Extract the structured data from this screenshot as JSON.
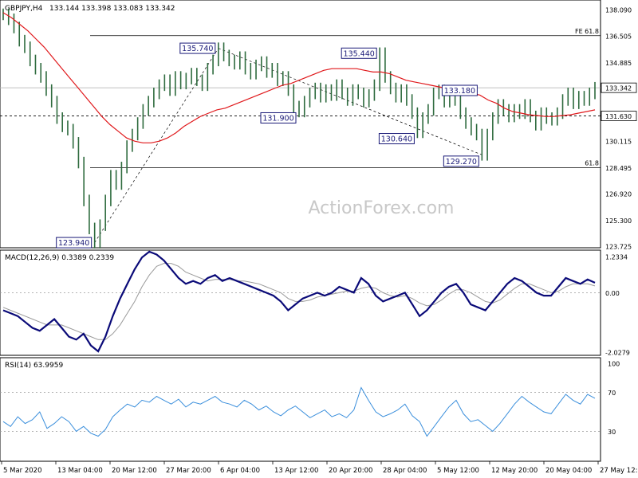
{
  "header": {
    "symbol": "GBPJPY,H4",
    "ohlc": "133.144 133.398 133.083 133.342"
  },
  "watermark": "ActionForex.com",
  "colors": {
    "price": "#2e6b3e",
    "ema": "#e0191c",
    "macd": "#0a0a78",
    "signal": "#9a9a9a",
    "rsi": "#3b8fdc",
    "label_border": "#1a1a78",
    "label_text": "#1a1a78"
  },
  "chart_data": [
    {
      "type": "line",
      "panel": "price",
      "title": "GBPJPY,H4",
      "y_ticks": [
        "138.090",
        "136.505",
        "134.885",
        "133.342",
        "131.630",
        "130.115",
        "128.495",
        "126.920",
        "125.300",
        "123.725"
      ],
      "ylim": [
        123.725,
        138.09
      ],
      "x_ticks": [
        "5 Mar 2020",
        "13 Mar 04:00",
        "20 Mar 12:00",
        "27 Mar 20:00",
        "6 Apr 04:00",
        "13 Apr 12:00",
        "20 Apr 20:00",
        "28 Apr 04:00",
        "5 May 12:00",
        "12 May 20:00",
        "20 May 04:00",
        "27 May 12:00"
      ],
      "series": [
        {
          "values": [
            137.8,
            137.5,
            137.0,
            136.2,
            135.8,
            135.0,
            134.5,
            134.0,
            133.2,
            132.5,
            131.5,
            131.0,
            130.8,
            130.0,
            128.8,
            126.5,
            124.8,
            123.94,
            125.0,
            126.5,
            128.0,
            127.5,
            128.5,
            129.8,
            130.5,
            131.2,
            132.0,
            132.5,
            133.0,
            133.5,
            133.8,
            133.2,
            134.0,
            133.6,
            133.9,
            134.2,
            133.8,
            133.5,
            134.5,
            135.0,
            135.74,
            135.3,
            135.0,
            134.8,
            135.2,
            134.5,
            134.2,
            134.7,
            134.9,
            134.3,
            134.5,
            133.8,
            134.0,
            133.2,
            132.2,
            131.9,
            132.5,
            133.0,
            133.3,
            132.8,
            133.2,
            132.9,
            133.5,
            133.0,
            132.6,
            133.2,
            133.0,
            132.5,
            132.9,
            133.5,
            135.44,
            134.0,
            133.3,
            132.8,
            133.2,
            132.6,
            131.8,
            130.64,
            131.5,
            132.0,
            133.0,
            133.18,
            132.5,
            133.0,
            132.6,
            131.8,
            131.2,
            130.8,
            130.5,
            129.27,
            130.5,
            131.5,
            132.3,
            132.0,
            131.6,
            132.0,
            131.8,
            132.3,
            131.6,
            131.1,
            131.8,
            131.5,
            131.4,
            131.8,
            132.6,
            133.0,
            132.4,
            132.8,
            132.6,
            133.0,
            133.342
          ]
        },
        {
          "values": [
            137.9,
            137.6,
            137.2,
            136.8,
            136.3,
            135.8,
            135.2,
            134.6,
            134.0,
            133.4,
            132.8,
            132.2,
            131.6,
            131.1,
            130.7,
            130.3,
            130.1,
            130.0,
            130.0,
            130.1,
            130.3,
            130.6,
            131.0,
            131.3,
            131.6,
            131.8,
            132.0,
            132.1,
            132.3,
            132.5,
            132.7,
            132.9,
            133.1,
            133.3,
            133.5,
            133.6,
            133.8,
            134.0,
            134.2,
            134.4,
            134.5,
            134.5,
            134.5,
            134.5,
            134.4,
            134.3,
            134.3,
            134.2,
            134.0,
            133.8,
            133.7,
            133.6,
            133.5,
            133.4,
            133.3,
            133.2,
            133.1,
            133.0,
            132.9,
            132.6,
            132.4,
            132.1,
            131.9,
            131.8,
            131.7,
            131.65,
            131.6,
            131.6,
            131.65,
            131.7,
            131.8,
            131.9,
            132.0
          ]
        }
      ],
      "levels": [
        {
          "name": "FE 61.8",
          "value": 136.505
        },
        {
          "name": "",
          "value": 133.342
        },
        {
          "name": "",
          "value": 131.63
        },
        {
          "name": "61.8",
          "value": 128.495
        }
      ],
      "annotations": [
        "123.940",
        "135.740",
        "131.900",
        "135.440",
        "133.180",
        "130.640",
        "129.270"
      ]
    },
    {
      "type": "line",
      "panel": "macd",
      "title": "MACD(12,26,9) 0.3389 0.2339",
      "y_ticks": [
        "1.2334",
        "0.00",
        "-2.0279"
      ],
      "ylim": [
        -2.0279,
        1.2334
      ],
      "series": [
        {
          "values": [
            -0.6,
            -0.7,
            -0.8,
            -1.0,
            -1.2,
            -1.3,
            -1.1,
            -0.9,
            -1.2,
            -1.5,
            -1.6,
            -1.4,
            -1.8,
            -2.0,
            -1.5,
            -0.8,
            -0.2,
            0.3,
            0.8,
            1.2,
            1.4,
            1.3,
            1.1,
            0.8,
            0.5,
            0.3,
            0.4,
            0.3,
            0.5,
            0.6,
            0.4,
            0.5,
            0.4,
            0.3,
            0.2,
            0.1,
            0.0,
            -0.1,
            -0.3,
            -0.6,
            -0.4,
            -0.2,
            -0.1,
            0.0,
            -0.1,
            0.0,
            0.2,
            0.1,
            0.0,
            0.5,
            0.3,
            -0.1,
            -0.3,
            -0.2,
            -0.1,
            0.0,
            -0.4,
            -0.8,
            -0.6,
            -0.3,
            0.0,
            0.2,
            0.3,
            0.0,
            -0.4,
            -0.5,
            -0.6,
            -0.3,
            0.0,
            0.3,
            0.5,
            0.4,
            0.2,
            0.0,
            -0.1,
            -0.1,
            0.2,
            0.5,
            0.4,
            0.3,
            0.45,
            0.34
          ]
        },
        {
          "values": [
            -0.5,
            -0.6,
            -0.7,
            -0.8,
            -0.9,
            -1.0,
            -1.1,
            -1.1,
            -1.1,
            -1.2,
            -1.3,
            -1.4,
            -1.5,
            -1.6,
            -1.6,
            -1.4,
            -1.1,
            -0.7,
            -0.3,
            0.2,
            0.6,
            0.9,
            1.0,
            1.0,
            0.9,
            0.7,
            0.6,
            0.5,
            0.4,
            0.45,
            0.45,
            0.45,
            0.4,
            0.4,
            0.35,
            0.3,
            0.2,
            0.1,
            0.0,
            -0.2,
            -0.3,
            -0.3,
            -0.25,
            -0.15,
            -0.1,
            -0.05,
            0.0,
            0.05,
            0.05,
            0.15,
            0.2,
            0.15,
            0.0,
            -0.1,
            -0.15,
            -0.1,
            -0.2,
            -0.35,
            -0.45,
            -0.4,
            -0.25,
            -0.05,
            0.1,
            0.1,
            0.0,
            -0.15,
            -0.3,
            -0.35,
            -0.25,
            -0.05,
            0.15,
            0.3,
            0.3,
            0.2,
            0.1,
            0.0,
            0.05,
            0.2,
            0.3,
            0.3,
            0.3,
            0.23
          ]
        }
      ]
    },
    {
      "type": "line",
      "panel": "rsi",
      "title": "RSI(14) 63.9959",
      "y_ticks": [
        "100",
        "70",
        "30",
        "0"
      ],
      "ylim": [
        0,
        100
      ],
      "levels": [
        {
          "value": 70
        },
        {
          "value": 30
        }
      ],
      "series": [
        {
          "values": [
            40,
            35,
            45,
            38,
            42,
            50,
            33,
            38,
            45,
            40,
            30,
            35,
            28,
            25,
            32,
            45,
            52,
            58,
            55,
            62,
            60,
            66,
            62,
            58,
            63,
            55,
            60,
            58,
            62,
            66,
            60,
            58,
            55,
            62,
            58,
            52,
            56,
            50,
            46,
            52,
            56,
            50,
            44,
            48,
            52,
            45,
            48,
            44,
            52,
            75,
            62,
            50,
            45,
            48,
            52,
            58,
            46,
            40,
            25,
            35,
            45,
            55,
            62,
            48,
            40,
            42,
            36,
            30,
            38,
            48,
            58,
            66,
            60,
            55,
            50,
            48,
            58,
            68,
            62,
            58,
            68,
            64
          ]
        }
      ]
    }
  ]
}
